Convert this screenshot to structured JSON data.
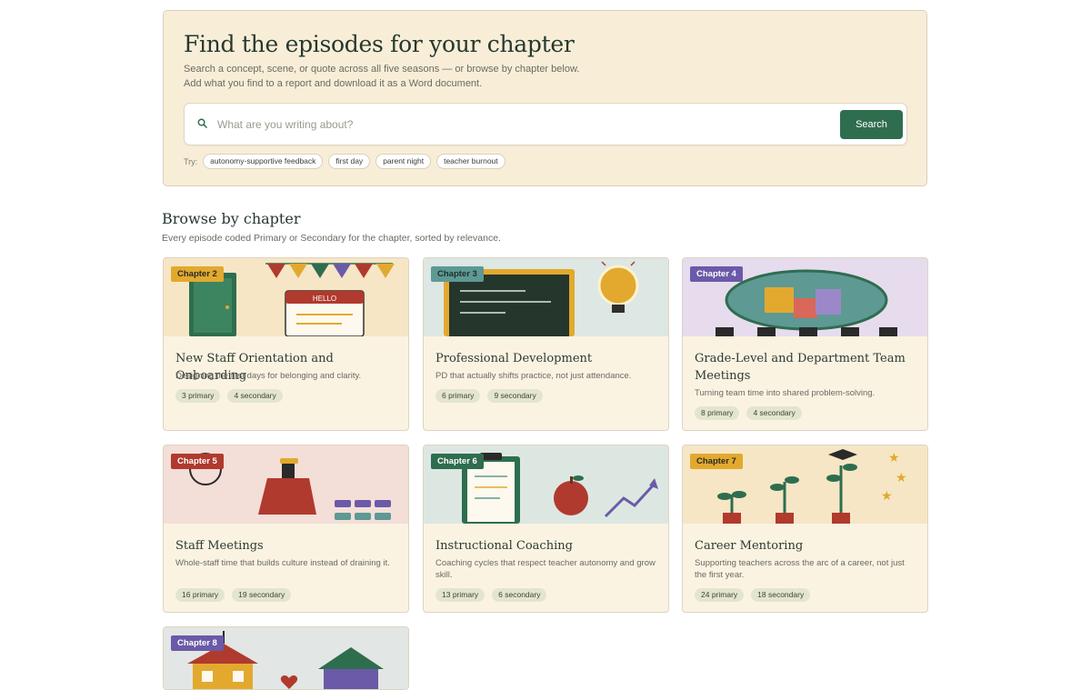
{
  "hero": {
    "title": "Find the episodes for your chapter",
    "subtitle": "Search a concept, scene, or quote across all five seasons — or browse by chapter below. Add what you find to a report and download it as a Word document.",
    "search_placeholder": "What are you writing about?",
    "search_icon": "search-icon",
    "search_button": "Search",
    "try_label": "Try:",
    "suggestions": [
      "autonomy-supportive feedback",
      "first day",
      "parent night",
      "teacher burnout"
    ]
  },
  "browse": {
    "title": "Browse by chapter",
    "subtitle": "Every episode coded Primary or Secondary for the chapter, sorted by relevance."
  },
  "chapters": [
    {
      "badge": "Chapter 2",
      "badge_color": "#e2a92e",
      "bg": "#f6e6c5",
      "title": "New Staff Orientation and Onboarding",
      "desc": "Designing the first days for belonging and clarity.",
      "primary": "3 primary",
      "secondary": "4 secondary"
    },
    {
      "badge": "Chapter 3",
      "badge_color": "#5e9994",
      "bg": "#dde7e3",
      "title": "Professional Development",
      "desc": "PD that actually shifts practice, not just attendance.",
      "primary": "6 primary",
      "secondary": "9 secondary"
    },
    {
      "badge": "Chapter 4",
      "badge_color": "#6b5aa8",
      "bg": "#e6dcee",
      "title": "Grade-Level and Department Team Meetings",
      "desc": "Turning team time into shared problem-solving.",
      "primary": "8 primary",
      "secondary": "4 secondary"
    },
    {
      "badge": "Chapter 5",
      "badge_color": "#b03a2e",
      "bg": "#f4ded8",
      "title": "Staff Meetings",
      "desc": "Whole-staff time that builds culture instead of draining it.",
      "primary": "16 primary",
      "secondary": "19 secondary"
    },
    {
      "badge": "Chapter 6",
      "badge_color": "#2f6d4f",
      "bg": "#dde7e2",
      "title": "Instructional Coaching",
      "desc": "Coaching cycles that respect teacher autonomy and grow skill.",
      "primary": "13 primary",
      "secondary": "6 secondary"
    },
    {
      "badge": "Chapter 7",
      "badge_color": "#e2a92e",
      "bg": "#f6e6c5",
      "title": "Career Mentoring",
      "desc": "Supporting teachers across the arc of a career, not just the first year.",
      "primary": "24 primary",
      "secondary": "18 secondary"
    },
    {
      "badge": "Chapter 8",
      "badge_color": "#6b5aa8",
      "bg": "#e2e6e4",
      "title": "",
      "desc": "",
      "primary": "",
      "secondary": ""
    }
  ],
  "art": {
    "hello_sign": "HELLO"
  },
  "colors": {
    "accent_green": "#2f6d4f",
    "hero_bg": "#f8eed8",
    "card_bg": "#fbf3e2"
  }
}
